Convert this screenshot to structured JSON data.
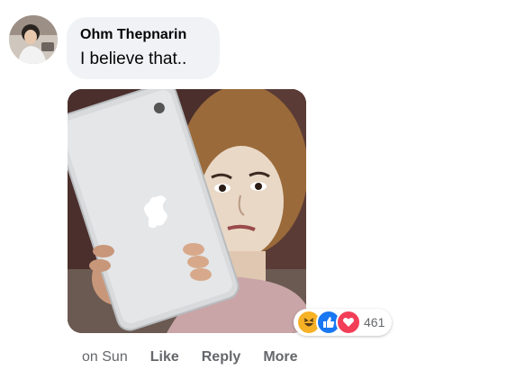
{
  "comment": {
    "author": "Ohm Thepnarin",
    "text": "I believe that..",
    "avatar_icon": "profile-photo",
    "image_alt_icon": "meme-photo"
  },
  "reactions": {
    "icons": [
      "haha-icon",
      "like-icon",
      "love-icon"
    ],
    "colors": {
      "haha": "#f7b125",
      "like": "#1877f2",
      "love": "#f33e58"
    },
    "count": "461"
  },
  "actions": {
    "time": "on Sun",
    "like_label": "Like",
    "reply_label": "Reply",
    "more_label": "More"
  }
}
